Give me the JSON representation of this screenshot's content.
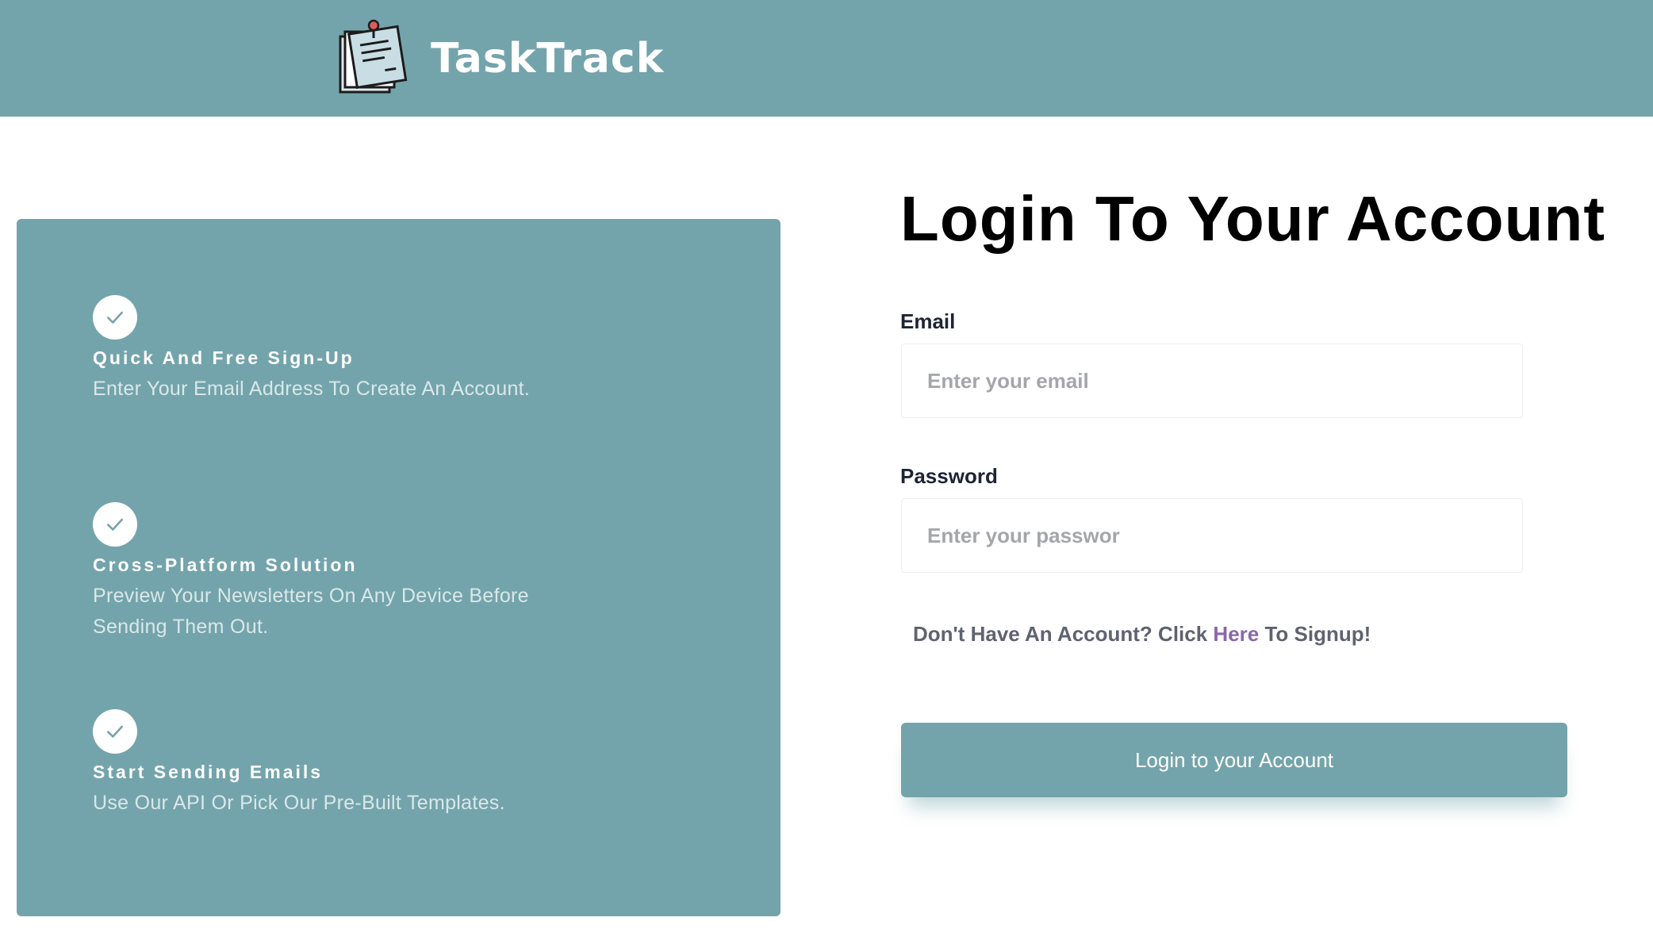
{
  "colors": {
    "accent": "#74a4ab",
    "link": "#8a67a8",
    "text_dark": "#000000",
    "label": "#1c2435"
  },
  "header": {
    "app_name": "TaskTrack",
    "logo_icon": "sticky-notes-pin-icon"
  },
  "features": [
    {
      "icon": "check-icon",
      "title": "Quick And Free Sign-Up",
      "description": "Enter Your Email Address To Create An Account."
    },
    {
      "icon": "check-icon",
      "title": "Cross-Platform Solution",
      "description": "Preview Your Newsletters On Any Device Before Sending Them Out."
    },
    {
      "icon": "check-icon",
      "title": "Start Sending Emails",
      "description": "Use Our API Or Pick Our Pre-Built Templates."
    }
  ],
  "login": {
    "title": "Login To Your Account",
    "email_label": "Email",
    "email_placeholder": "Enter your email",
    "email_value": "",
    "password_label": "Password",
    "password_placeholder": "Enter your passwor",
    "password_value": "",
    "signup_prefix": "Don't Have An Account? Click ",
    "signup_link": "Here",
    "signup_suffix": " To Signup!",
    "submit_label": "Login to your Account"
  }
}
